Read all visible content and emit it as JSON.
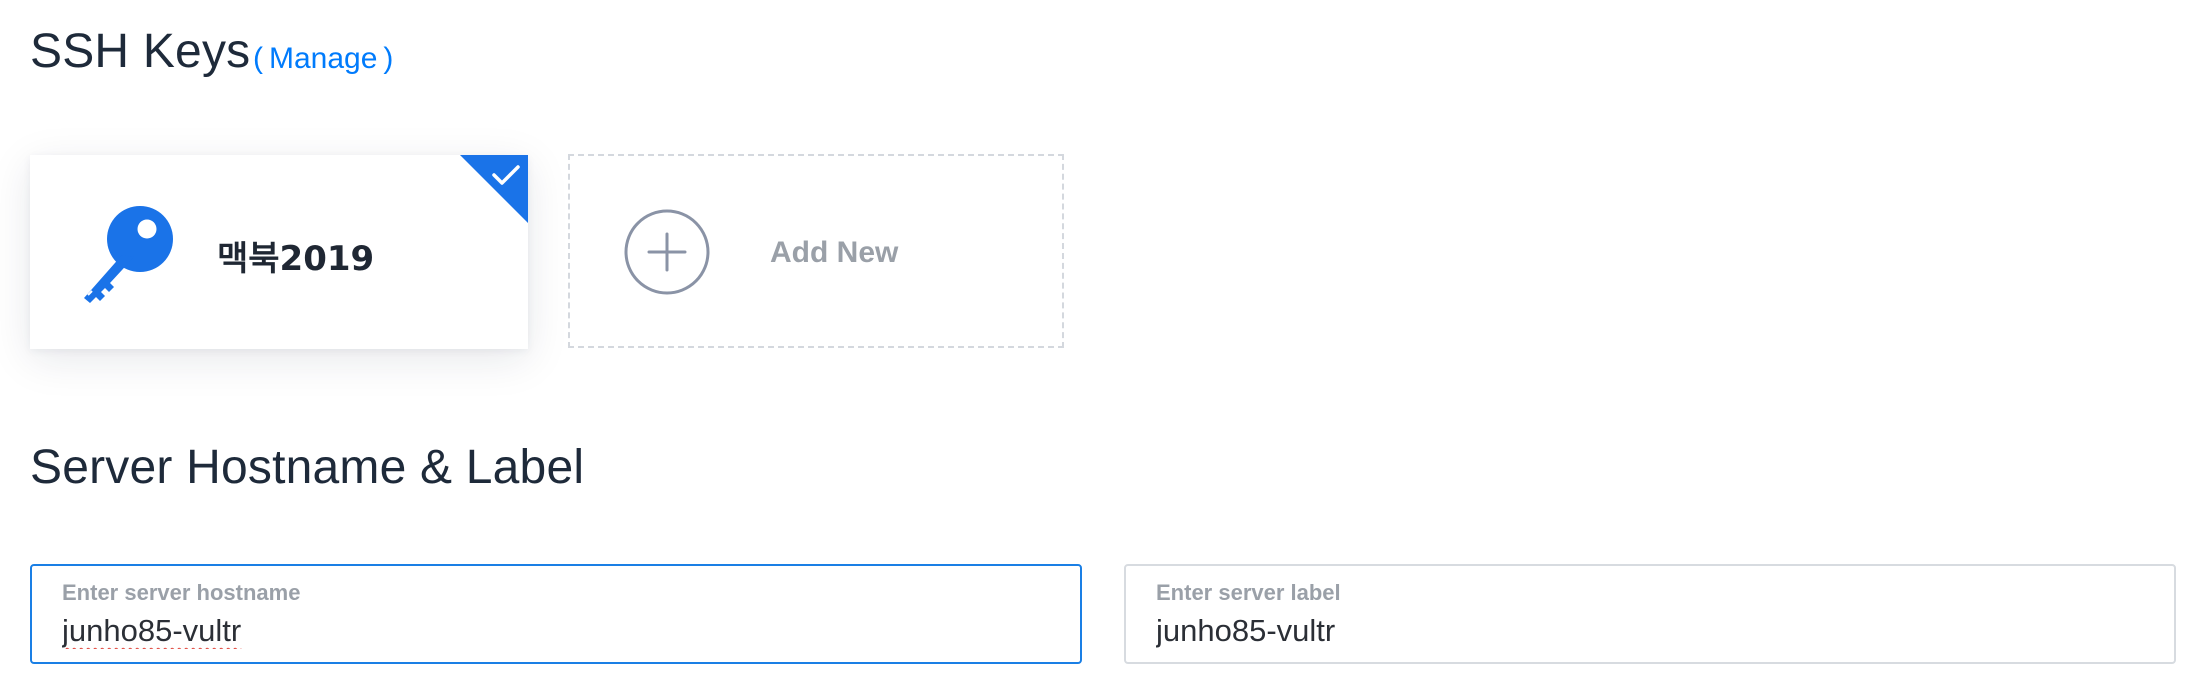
{
  "ssh_keys": {
    "title": "SSH Keys",
    "manage_link": {
      "open_paren": "(",
      "label": "Manage",
      "close_paren": ")"
    },
    "keys": [
      {
        "name": "맥북2019",
        "selected": true,
        "icon": "key-icon"
      }
    ],
    "add_new": {
      "label": "Add New",
      "icon": "plus-circle-icon"
    }
  },
  "hostname_label": {
    "title": "Server Hostname & Label",
    "hostname": {
      "label": "Enter server hostname",
      "value": "junho85-vultr",
      "focused": true
    },
    "server_label": {
      "label": "Enter server label",
      "value": "junho85-vultr"
    }
  },
  "colors": {
    "accent": "#007bfc",
    "focus_border": "#1a7fe5",
    "muted_text": "#9aa0a8",
    "heading": "#1e2a3a"
  }
}
